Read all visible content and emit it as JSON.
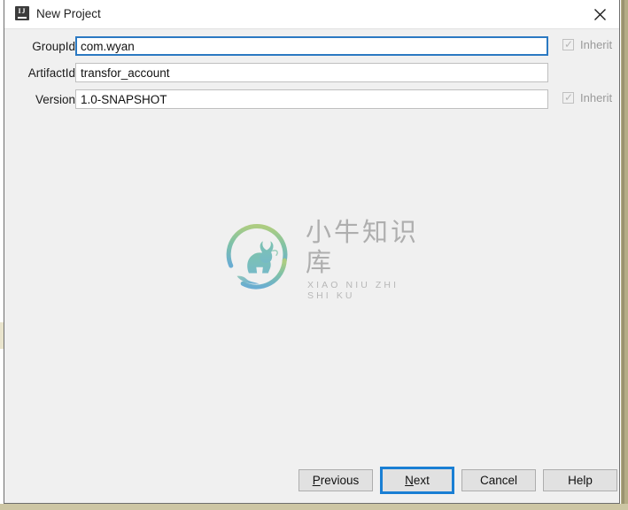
{
  "window": {
    "title": "New Project",
    "app_icon": "intellij-idea-icon",
    "icon_text": "IJ",
    "close_icon": "close-icon"
  },
  "form": {
    "rows": [
      {
        "label": "GroupId",
        "value": "com.wyan",
        "focused": true,
        "has_inherit": true,
        "inherit_label": "Inherit",
        "inherit_checked": true,
        "inherit_disabled": true
      },
      {
        "label": "ArtifactId",
        "value": "transfor_account",
        "focused": false,
        "has_inherit": false,
        "inherit_label": "",
        "inherit_checked": false,
        "inherit_disabled": false
      },
      {
        "label": "Version",
        "value": "1.0-SNAPSHOT",
        "focused": false,
        "has_inherit": true,
        "inherit_label": "Inherit",
        "inherit_checked": true,
        "inherit_disabled": true
      }
    ]
  },
  "watermark": {
    "chinese": "小牛知识库",
    "pinyin": "XIAO NIU ZHI SHI KU",
    "logo_name": "ox-circle-logo",
    "color_top": "#8dc06a",
    "color_bottom": "#5ba8cf"
  },
  "buttons": {
    "previous": {
      "prefix": "",
      "mnemonic": "P",
      "suffix": "revious"
    },
    "next": {
      "prefix": "",
      "mnemonic": "N",
      "suffix": "ext"
    },
    "cancel": {
      "prefix": "",
      "mnemonic": "",
      "suffix": "Cancel"
    },
    "help": {
      "prefix": "",
      "mnemonic": "",
      "suffix": "Help"
    }
  },
  "colors": {
    "dialog_bg": "#f0f0f0",
    "titlebar_bg": "#ffffff",
    "focus_blue": "#1a7fd4",
    "field_focus_border": "#2b79c2",
    "desktop_strip": "#cdc6a4"
  }
}
